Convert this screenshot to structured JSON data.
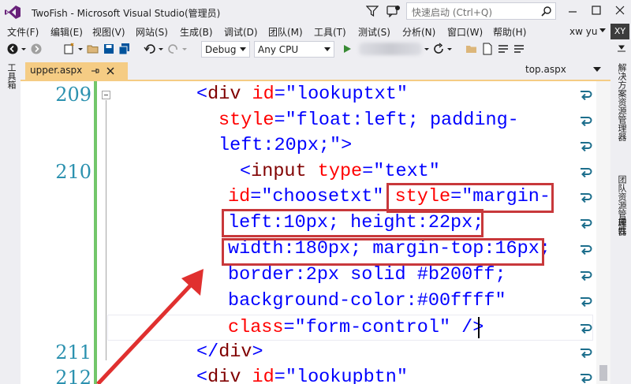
{
  "window": {
    "title": "TwoFish - Microsoft Visual Studio(管理员)",
    "quick_launch_placeholder": "快速启动 (Ctrl+Q)"
  },
  "menu": [
    "文件(F)",
    "编辑(E)",
    "视图(V)",
    "网站(S)",
    "生成(B)",
    "调试(D)",
    "团队(M)",
    "工具(T)",
    "测试(S)",
    "分析(N)",
    "窗口(W)",
    "帮助(H)"
  ],
  "user": {
    "name": "xw yu",
    "initials": "XY"
  },
  "toolbar": {
    "configuration": "Debug",
    "platform": "Any CPU"
  },
  "left_strip": {
    "toolbox_label": "工具箱"
  },
  "right_strip": {
    "solution_explorer": "解决方案资源管理器",
    "team_explorer": "团队资源管理器",
    "properties": "属性"
  },
  "tabs": {
    "active": "upper.aspx",
    "other": "top.aspx"
  },
  "editor": {
    "line_numbers": [
      "209",
      "210",
      "211",
      "212"
    ],
    "colors": {
      "tag": "#800000",
      "attr": "#ff0000",
      "value": "#0000ff",
      "linenum": "#2b91af",
      "highlight": "#c8383b",
      "gutter": "#72c66a"
    },
    "lines": [
      {
        "segs": [
          [
            "br",
            "<"
          ],
          [
            "tag",
            "div "
          ],
          [
            "attr",
            "id"
          ],
          [
            "br",
            "="
          ],
          [
            "val",
            "\"lookuptxt\""
          ]
        ]
      },
      {
        "segs": [
          [
            "attr",
            "style"
          ],
          [
            "br",
            "="
          ],
          [
            "val",
            "\"float:left; padding-"
          ]
        ]
      },
      {
        "segs": [
          [
            "val",
            "left:20px;\""
          ],
          [
            "br",
            ">"
          ]
        ]
      },
      {
        "segs": [
          [
            "br",
            "<"
          ],
          [
            "tag",
            "input "
          ],
          [
            "attr",
            "type"
          ],
          [
            "br",
            "="
          ],
          [
            "val",
            "\"text\""
          ]
        ]
      },
      {
        "segs": [
          [
            "attr",
            "id"
          ],
          [
            "br",
            "="
          ],
          [
            "val",
            "\"choosetxt\" "
          ],
          [
            "attr",
            "style"
          ],
          [
            "br",
            "="
          ],
          [
            "val",
            "\"margin-"
          ]
        ]
      },
      {
        "segs": [
          [
            "val",
            "left:10px; height:22px;"
          ]
        ]
      },
      {
        "segs": [
          [
            "val",
            "width:180px; margin-top:16px;"
          ]
        ]
      },
      {
        "segs": [
          [
            "val",
            "border:2px solid #b200ff;"
          ]
        ]
      },
      {
        "segs": [
          [
            "val",
            "background-color:#00ffff\""
          ]
        ]
      },
      {
        "segs": [
          [
            "attr",
            "class"
          ],
          [
            "br",
            "="
          ],
          [
            "val",
            "\"form-control\" "
          ],
          [
            "br",
            "/>"
          ]
        ]
      },
      {
        "segs": [
          [
            "br",
            "</"
          ],
          [
            "tag",
            "div"
          ],
          [
            "br",
            ">"
          ]
        ]
      },
      {
        "segs": [
          [
            "br",
            "<"
          ],
          [
            "tag",
            "div "
          ],
          [
            "attr",
            "id"
          ],
          [
            "br",
            "="
          ],
          [
            "val",
            "\"lookupbtn\""
          ]
        ]
      }
    ]
  }
}
